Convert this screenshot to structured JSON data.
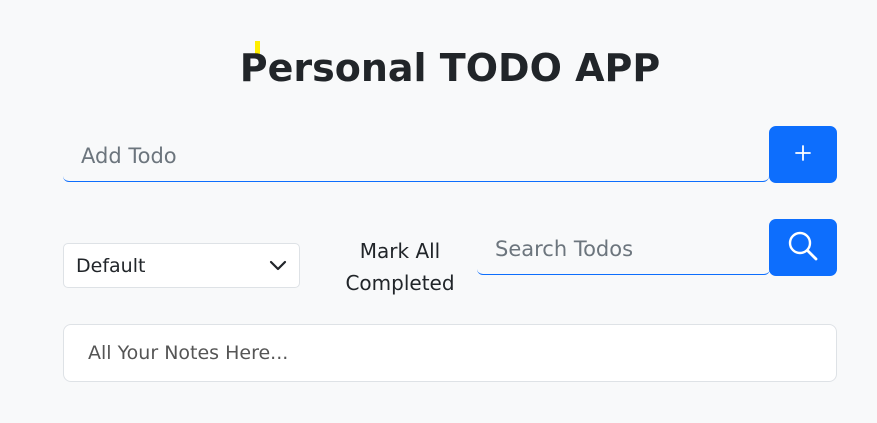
{
  "header": {
    "title": "Personal TODO APP",
    "accent_color": "#ffee00"
  },
  "add_todo": {
    "placeholder": "Add Todo",
    "value": "",
    "button_icon": "plus-icon"
  },
  "filter": {
    "selected": "Default",
    "icon": "chevron-down-icon"
  },
  "mark_all": {
    "line1": "Mark All",
    "line2": "Completed"
  },
  "search": {
    "placeholder": "Search Todos",
    "value": "",
    "button_icon": "search-icon"
  },
  "notes": {
    "empty_text": "All Your Notes Here..."
  },
  "colors": {
    "primary": "#0d6efd",
    "background": "#f8f9fa",
    "text": "#212529"
  }
}
